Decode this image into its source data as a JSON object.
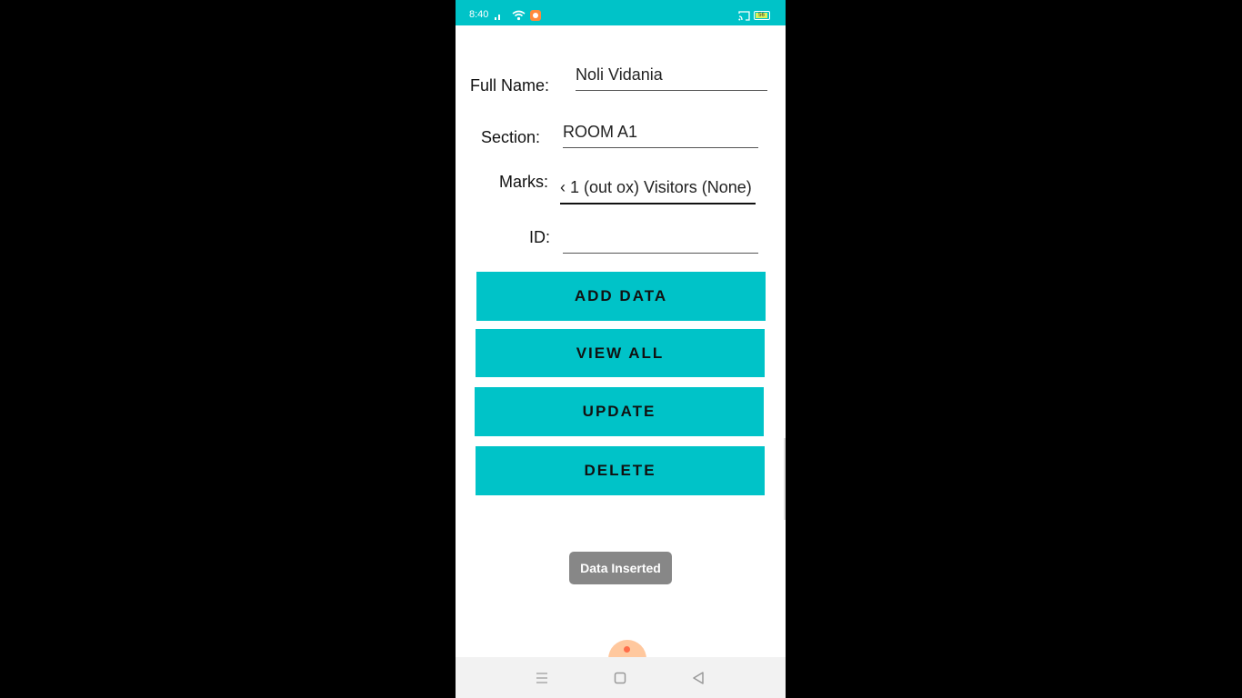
{
  "status_bar": {
    "time": "8:40",
    "icons": [
      "signal-icon",
      "wifi-icon",
      "notification-icon",
      "cast-icon",
      "battery-icon"
    ],
    "battery_text": "56",
    "color": "#00c3c8"
  },
  "form": {
    "full_name": {
      "label": "Full Name:",
      "value": "Noli Vidania"
    },
    "section": {
      "label": "Section:",
      "value": "ROOM A1"
    },
    "marks": {
      "label": "Marks:",
      "value": "‹ 1 (out ox) Visitors (None)"
    },
    "id": {
      "label": "ID:",
      "value": ""
    }
  },
  "buttons": {
    "add": "ADD DATA",
    "view_all": "VIEW ALL",
    "update": "UPDATE",
    "delete": "DELETE",
    "color": "#00c3c8"
  },
  "toast": {
    "text": "Data Inserted"
  },
  "nav_bar": {
    "icons": [
      "menu-icon",
      "home-square-icon",
      "back-triangle-icon"
    ]
  }
}
